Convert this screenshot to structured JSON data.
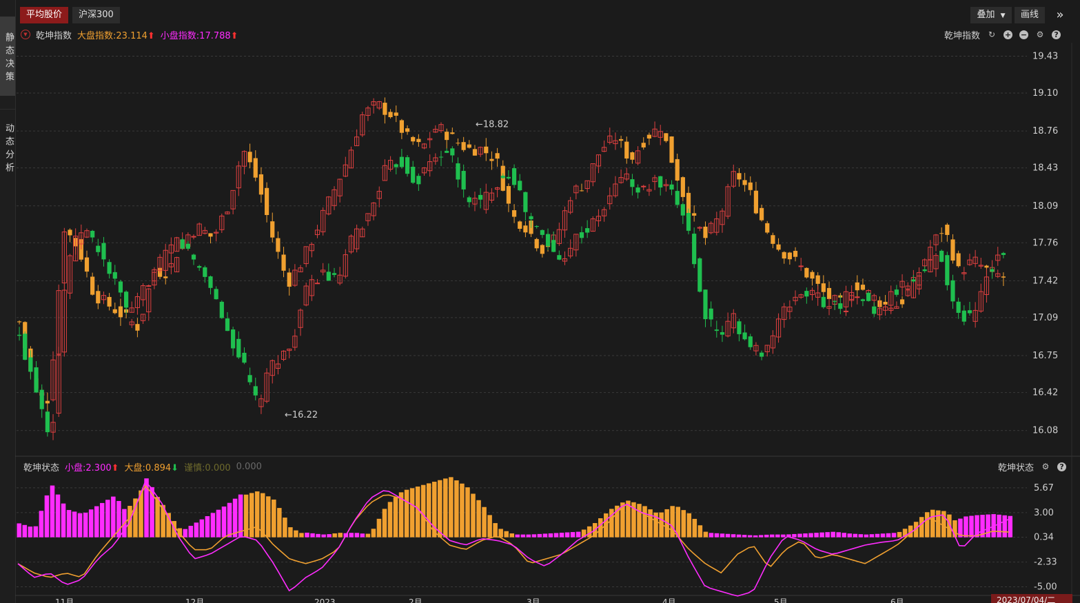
{
  "sidebar": {
    "static_tab": "静态决策",
    "dynamic_tab": "动态分析"
  },
  "top_tabs": [
    "平均股价",
    "沪深300"
  ],
  "toolbar": {
    "overlay": "叠加",
    "draw": "画线"
  },
  "main_header": {
    "name": "乾坤指数",
    "big_label": "大盘指数:23.114",
    "small_label": "小盘指数:17.788",
    "right_label": "乾坤指数"
  },
  "sub_header": {
    "name": "乾坤状态",
    "small_label": "小盘:2.300",
    "big_label": "大盘:0.894",
    "threshold_label": "谨慎:0.000",
    "extra_value": "0.000",
    "right_label": "乾坤状态"
  },
  "y_axis_main": [
    "19.43",
    "19.10",
    "18.76",
    "18.43",
    "18.09",
    "17.76",
    "17.42",
    "17.09",
    "16.75",
    "16.42",
    "16.08"
  ],
  "y_axis_sub": [
    "5.67",
    "3.00",
    "0.34",
    "-2.33",
    "-5.00"
  ],
  "x_axis": [
    "11月",
    "12月",
    "2023",
    "2月",
    "3月",
    "4月",
    "5月",
    "6月"
  ],
  "date_badge": "2023/07/04/二",
  "annotations": {
    "high": "18.82",
    "low": "16.22"
  },
  "colors": {
    "orange": "#f0a030",
    "magenta": "#ff2cff",
    "green": "#1fbf4f",
    "red": "#e04040",
    "grid": "#3a3a3a"
  },
  "chart_data": [
    {
      "type": "candlestick",
      "title": "乾坤指数",
      "ylim": [
        15.85,
        19.55
      ],
      "series": [
        {
          "name": "大盘指数",
          "close_path": [
            17.05,
            16.45,
            16.35,
            17.9,
            17.7,
            17.3,
            17.2,
            17.1,
            17.0,
            17.5,
            17.5,
            17.8,
            17.9,
            17.8,
            18.1,
            18.6,
            18.3,
            17.8,
            17.4,
            17.6,
            17.9,
            18.2,
            18.5,
            18.9,
            19.0,
            18.9,
            18.7,
            18.6,
            18.8,
            18.7,
            18.6,
            18.6,
            18.5,
            18.0,
            17.9,
            17.7,
            17.8,
            18.2,
            18.3,
            18.6,
            18.7,
            18.5,
            18.7,
            18.8,
            18.4,
            18.0,
            17.8,
            18.0,
            18.4,
            18.2,
            17.9,
            17.7,
            17.6,
            17.45,
            17.3,
            17.2,
            17.4,
            17.3,
            17.2,
            17.2,
            17.4,
            17.7,
            17.9,
            17.5,
            17.6,
            17.5,
            17.45
          ]
        },
        {
          "name": "小盘指数",
          "close_path": [
            16.9,
            16.5,
            16.0,
            17.6,
            17.9,
            17.7,
            17.4,
            17.1,
            17.4,
            17.6,
            17.8,
            17.6,
            17.4,
            17.0,
            16.7,
            16.3,
            16.7,
            16.8,
            17.3,
            17.5,
            17.4,
            17.8,
            18.0,
            18.4,
            18.5,
            18.3,
            18.5,
            18.6,
            18.2,
            18.1,
            18.3,
            18.4,
            18.0,
            17.8,
            17.6,
            17.8,
            17.9,
            18.1,
            18.4,
            18.2,
            18.3,
            18.2,
            18.0,
            17.2,
            16.9,
            17.1,
            16.8,
            16.8,
            17.1,
            17.3,
            17.3,
            17.2,
            17.2,
            17.3,
            17.1,
            17.3,
            17.4,
            17.5,
            17.7,
            17.1,
            17.1,
            17.5,
            17.7
          ]
        }
      ]
    },
    {
      "type": "bar+line",
      "title": "乾坤状态",
      "ylim": [
        -6.0,
        7.0
      ],
      "series": [
        {
          "name": "小盘",
          "values": [
            1.5,
            1.0,
            5.8,
            3.0,
            2.5,
            3.5,
            4.5,
            2.0,
            6.5,
            3.0,
            0.5,
            1.5,
            2.5,
            3.5,
            4.8,
            3.5,
            1.5,
            0.3,
            0.5,
            0.3,
            0.4,
            0.5,
            0.3,
            0.2,
            0.3,
            0.2,
            0.4,
            0.3,
            0.3,
            0.3,
            0.4,
            0.3,
            0.3,
            0.4,
            0.5,
            0.6,
            1.0,
            1.5,
            1.0,
            0.5,
            0.3,
            0.4,
            0.3,
            0.5,
            0.4,
            0.3,
            0.2,
            0.3,
            0.3,
            0.4,
            0.5,
            0.6,
            0.4,
            0.3,
            0.4,
            0.5,
            0.5,
            0.4,
            0.6,
            2.2,
            2.4,
            2.5,
            2.3
          ]
        },
        {
          "name": "大盘",
          "values": [
            0.2,
            0.1,
            0.5,
            0.8,
            1.0,
            1.2,
            2.0,
            3.5,
            6.0,
            3.5,
            1.0,
            0.5,
            1.5,
            3.0,
            4.5,
            5.0,
            4.0,
            1.0,
            0.2,
            0.2,
            0.5,
            0.3,
            0.4,
            3.5,
            5.0,
            5.5,
            6.0,
            6.5,
            5.5,
            3.5,
            1.0,
            0.3,
            0.2,
            0.1,
            0.2,
            0.5,
            1.5,
            3.0,
            4.0,
            3.5,
            2.5,
            3.5,
            2.5,
            0.5,
            0.2,
            0.1,
            0.2,
            0.1,
            0.3,
            0.2,
            0.3,
            0.4,
            0.2,
            0.1,
            0.2,
            0.5,
            1.5,
            3.0,
            2.8,
            1.0,
            0.8,
            1.2,
            0.9
          ]
        },
        {
          "name": "小盘线",
          "values": [
            -2.5,
            -4.0,
            -3.5,
            -4.8,
            -4.2,
            -2.0,
            -0.5,
            2.0,
            6.5,
            4.0,
            0.5,
            -2.0,
            -1.5,
            -0.5,
            0.5,
            0.0,
            -2.5,
            -5.5,
            -4.0,
            -3.0,
            -1.0,
            2.0,
            4.5,
            5.5,
            4.5,
            3.5,
            1.5,
            0.0,
            -0.5,
            0.2,
            0.0,
            -0.5,
            -2.0,
            -2.8,
            -1.5,
            0.0,
            1.0,
            2.5,
            4.0,
            3.0,
            2.5,
            1.5,
            -2.0,
            -5.0,
            -5.5,
            -6.0,
            -5.5,
            -2.0,
            0.5,
            0.0,
            -1.0,
            -1.5,
            -1.0,
            -0.5,
            -0.2,
            0.0,
            1.0,
            2.5,
            2.8,
            -1.0,
            0.8,
            1.5,
            2.3
          ]
        },
        {
          "name": "大盘线",
          "values": [
            -2.5,
            -3.5,
            -4.0,
            -3.5,
            -4.0,
            -1.5,
            0.5,
            2.5,
            6.0,
            3.5,
            1.0,
            -1.0,
            -1.0,
            0.5,
            1.0,
            1.5,
            -0.5,
            -2.0,
            -2.5,
            -2.0,
            -1.0,
            2.0,
            4.0,
            5.0,
            4.5,
            3.5,
            1.0,
            -0.5,
            -1.0,
            0.0,
            0.5,
            -0.5,
            -2.5,
            -2.0,
            -1.5,
            -0.5,
            0.5,
            2.0,
            4.0,
            3.0,
            2.0,
            1.0,
            -1.0,
            -2.5,
            -3.5,
            -1.5,
            -0.5,
            -3.0,
            -1.0,
            0.0,
            -2.0,
            -1.5,
            -2.0,
            -2.5,
            -1.5,
            -0.5,
            1.0,
            2.5,
            1.5,
            0.5,
            0.5,
            1.0,
            0.9
          ]
        }
      ]
    }
  ]
}
